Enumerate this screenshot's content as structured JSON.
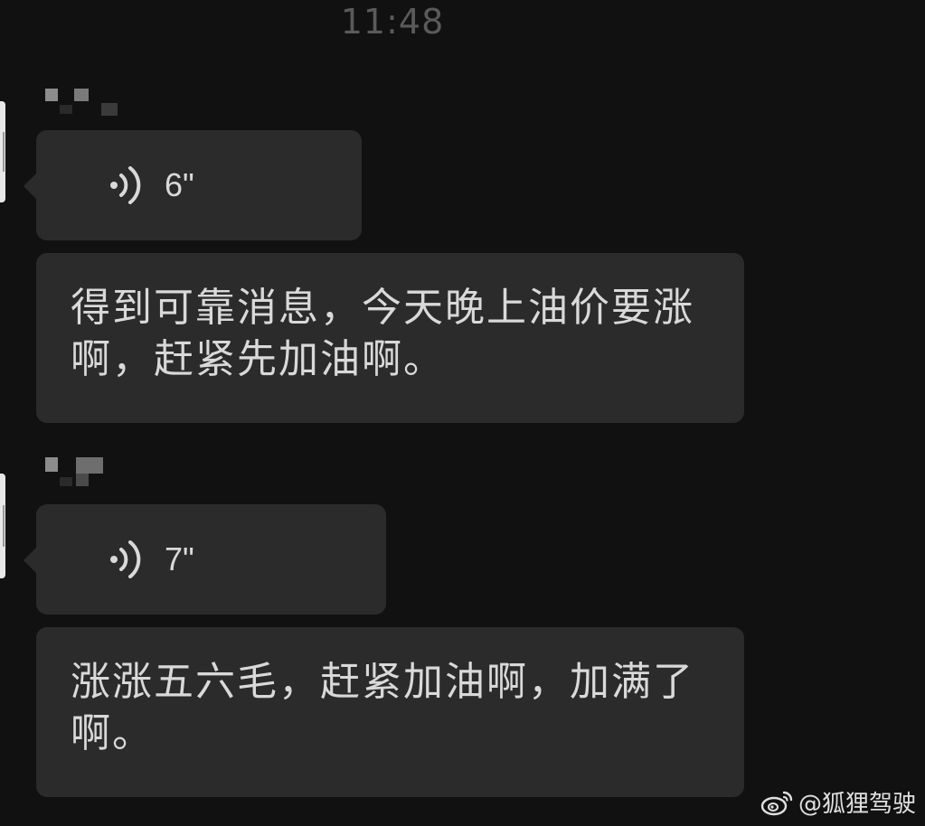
{
  "chat": {
    "timestamp": "11:48",
    "messages": [
      {
        "type": "voice",
        "duration": "6\"",
        "icon": "voice-wave-icon"
      },
      {
        "type": "text",
        "text": "得到可靠消息，今天晚上油价要涨啊，赶紧先加油啊。"
      },
      {
        "type": "voice",
        "duration": "7\"",
        "icon": "voice-wave-icon"
      },
      {
        "type": "text",
        "text": "涨涨五六毛，赶紧加油啊，加满了啊。"
      }
    ]
  },
  "watermark": {
    "icon": "weibo-logo-icon",
    "text": "@狐狸驾驶"
  },
  "colors": {
    "background": "#111111",
    "bubble": "#2b2b2b",
    "text": "#d9d9d9",
    "timestamp": "#5a5a5a"
  }
}
